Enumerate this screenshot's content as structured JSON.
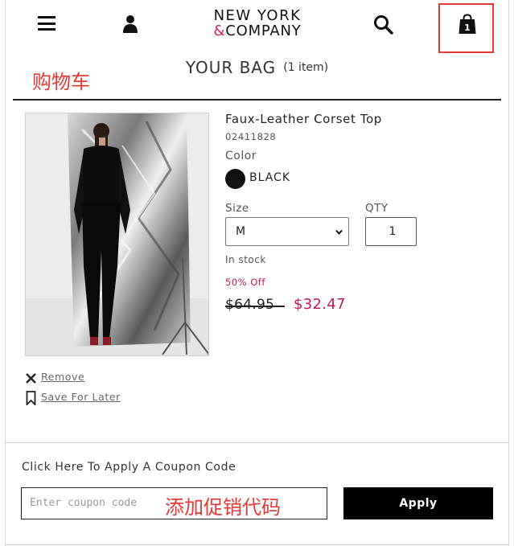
{
  "header": {
    "logo_line1": "NEW YORK",
    "logo_amp": "&",
    "logo_line2": "COMPANY",
    "bag_count": "1",
    "icons": [
      "menu-icon",
      "account-icon",
      "search-icon",
      "shopping-bag-icon"
    ]
  },
  "bag": {
    "title": "YOUR BAG",
    "item_count": "(1 item)"
  },
  "annotations": {
    "cart": "购物车",
    "coupon": "添加促销代码",
    "color": "#e53935"
  },
  "item": {
    "name": "Faux-Leather Corset Top",
    "sku": "02411828",
    "color_label": "Color",
    "color_value": "BLACK",
    "size_label": "Size",
    "size_value": "M",
    "qty_label": "QTY",
    "qty_value": "1",
    "stock": "In stock",
    "discount": "50% Off",
    "price_original": "$64.95",
    "price_sale": "$32.47",
    "remove_label": "Remove",
    "save_label": "Save For Later"
  },
  "coupon": {
    "title": "Click Here To Apply A Coupon Code",
    "placeholder": "Enter coupon code",
    "apply_label": "Apply"
  },
  "colors": {
    "accent": "#c2185b",
    "button_bg": "#000000",
    "highlight_box": "#e53935"
  }
}
